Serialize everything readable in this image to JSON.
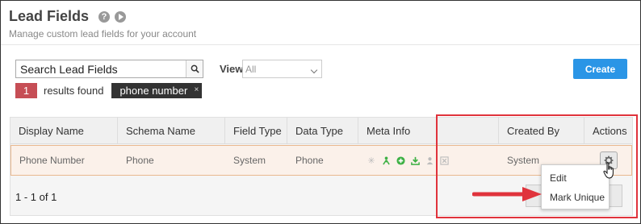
{
  "header": {
    "title": "Lead Fields",
    "subtitle": "Manage custom lead fields for your account"
  },
  "toolbar": {
    "search_value": "Search Lead Fields",
    "view_label": "View",
    "view_selected": "All",
    "create_label": "Create"
  },
  "results": {
    "count": "1",
    "label": "results found",
    "filter_chip": "phone number",
    "chip_close": "×"
  },
  "table": {
    "columns": [
      "Display Name",
      "Schema Name",
      "Field Type",
      "Data Type",
      "Meta Info",
      "Created By",
      "Actions"
    ],
    "rows": [
      {
        "display_name": "Phone Number",
        "schema_name": "Phone",
        "field_type": "System",
        "data_type": "Phone",
        "created_by": "System"
      }
    ],
    "pagination": "1 - 1 of 1"
  },
  "meta_icons": [
    "asterisk-icon",
    "person-up-icon",
    "plus-circle-icon",
    "download-icon",
    "person-icon",
    "excel-icon"
  ],
  "actions_menu": {
    "items": [
      "Edit",
      "Mark Unique"
    ]
  },
  "colors": {
    "accent": "#2a95e6",
    "count_badge": "#c64e55",
    "chip": "#333333",
    "highlight": "#e0333c",
    "row_highlight": "#fbf1ea",
    "meta_green": "#3cb043"
  }
}
